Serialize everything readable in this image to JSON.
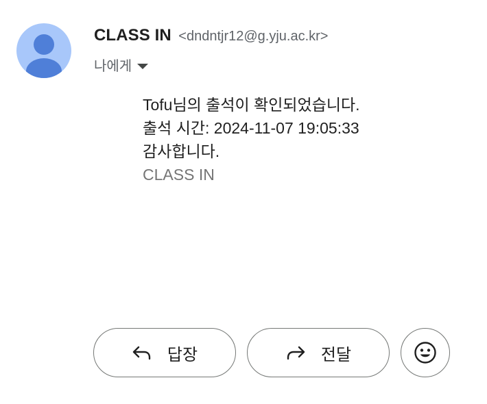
{
  "sender": {
    "name": "CLASS IN",
    "email": "<dndntjr12@g.yju.ac.kr>"
  },
  "recipient": {
    "label": "나에게"
  },
  "message": {
    "line1": "Tofu님의 출석이 확인되었습니다.",
    "line2": "출석 시간: 2024-11-07 19:05:33",
    "line3": "감사합니다.",
    "signature": "CLASS IN"
  },
  "actions": {
    "reply_label": "답장",
    "forward_label": "전달"
  },
  "icons": {
    "avatar": "person-icon",
    "reply": "reply-arrow-icon",
    "forward": "forward-arrow-icon",
    "emoji": "smiley-icon"
  },
  "colors": {
    "avatar_bg": "#a8c7fa",
    "avatar_fg": "#4f7fd8"
  }
}
